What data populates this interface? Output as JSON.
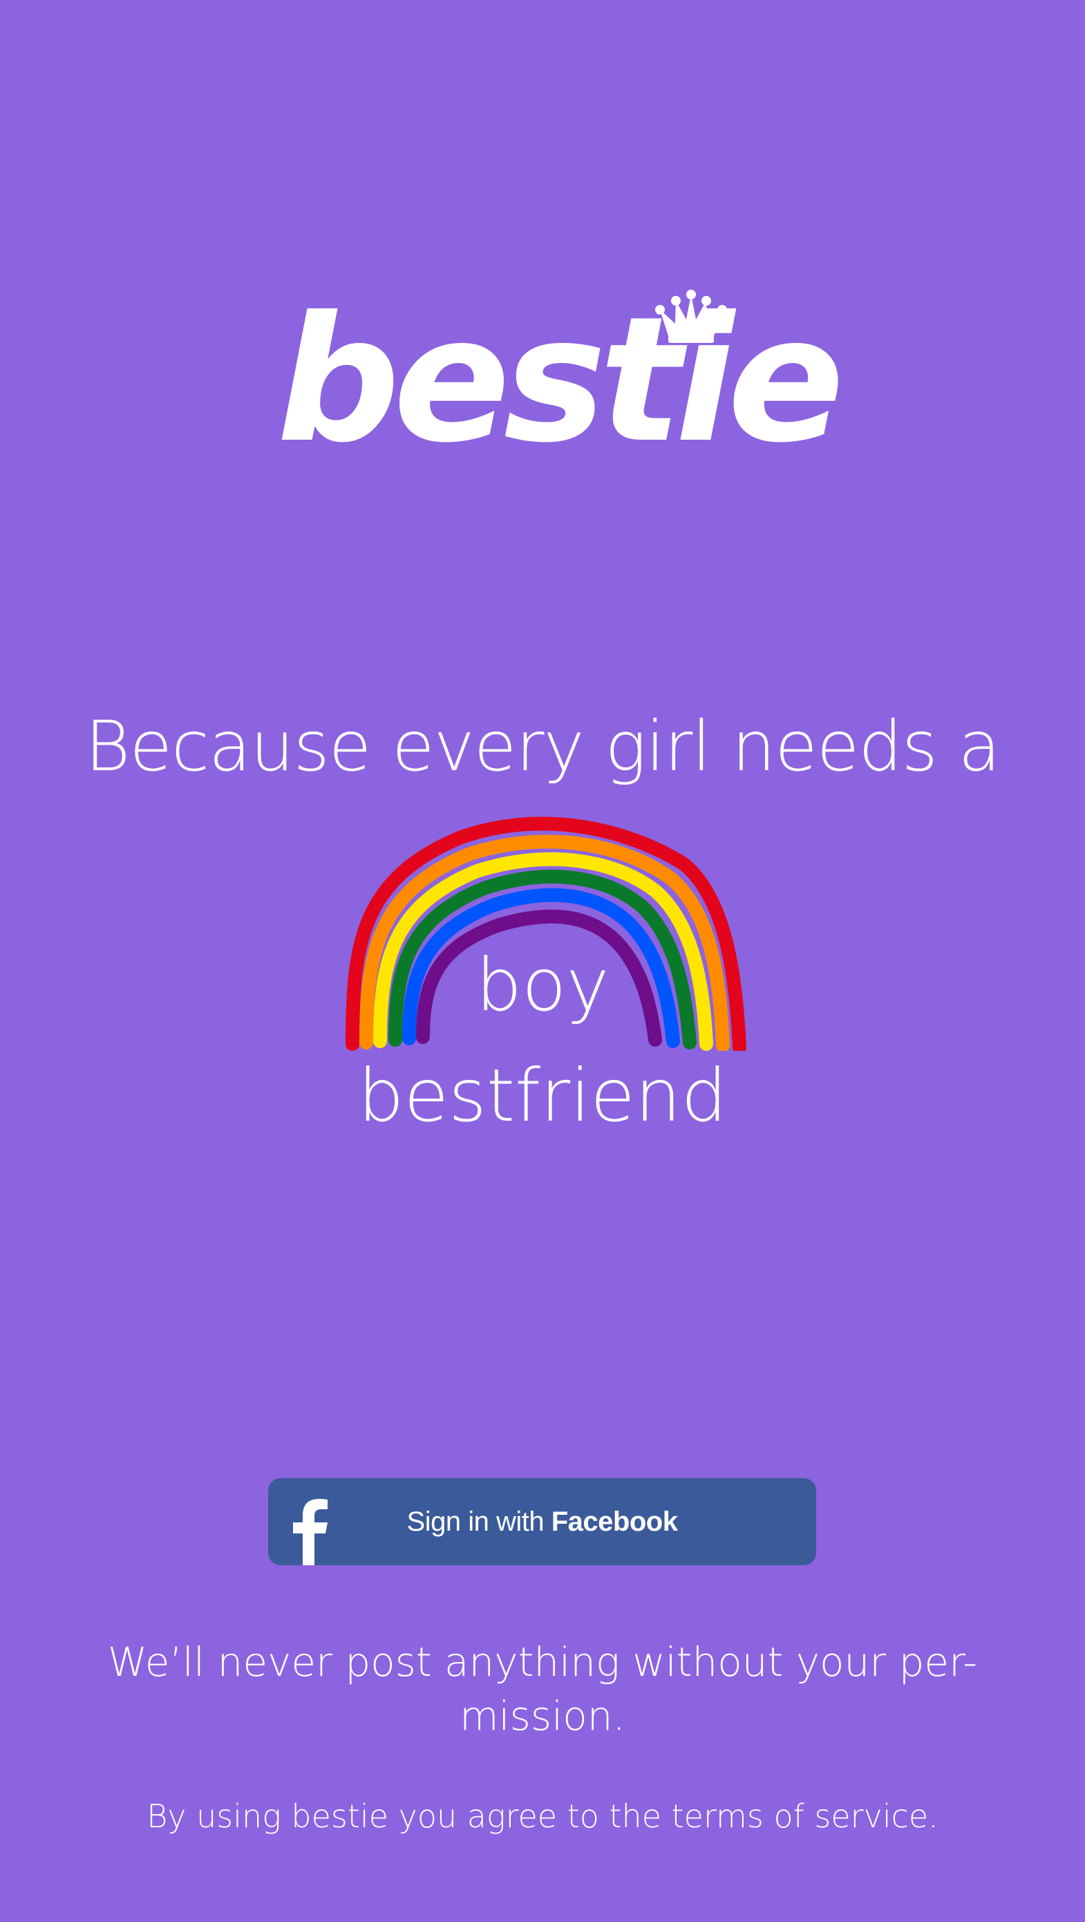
{
  "app": {
    "name": "bestie",
    "background_color": "#8C64E0"
  },
  "logo": {
    "wordmark": "bestie",
    "crown_icon": "crown-icon"
  },
  "hero": {
    "headline": "Because every girl needs a",
    "rainbow_icon": "rainbow-icon",
    "line_boy": "boy",
    "line_bestfriend": "bestfriend"
  },
  "signin": {
    "icon": "facebook-icon",
    "label_prefix": "Sign in with ",
    "label_brand": "Facebook",
    "button_color": "#3B5A9A"
  },
  "footer": {
    "privacy_line1": "We’ll never post anything without your per-",
    "privacy_line2": "mission.",
    "terms": "By using bestie you agree to the terms of service."
  }
}
